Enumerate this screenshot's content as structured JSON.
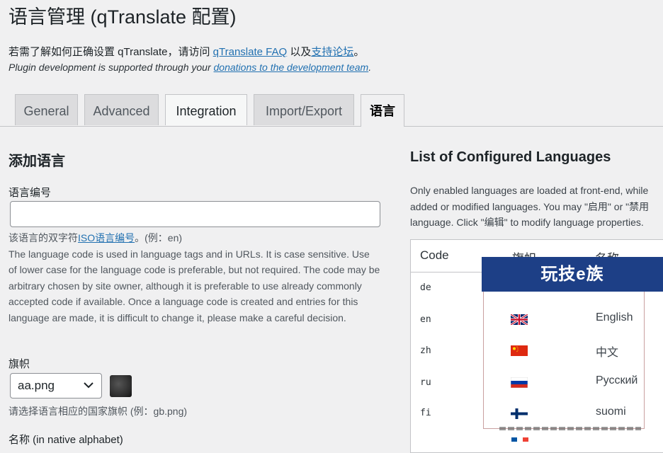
{
  "page_title": "语言管理 (qTranslate 配置)",
  "intro": {
    "prefix": "若需了解如何正确设置 qTranslate，请访问 ",
    "faq_link": "qTranslate FAQ",
    "middle": " 以及",
    "forum_link": "支持论坛",
    "suffix": "。"
  },
  "intro2": {
    "prefix": "Plugin development is supported through your ",
    "link": "donations to the development team",
    "suffix": "."
  },
  "tabs": [
    "General",
    "Advanced",
    "Integration",
    "Import/Export",
    "语言"
  ],
  "add_language": {
    "title": "添加语言",
    "code_label": "语言编号",
    "code_value": "",
    "hint_prefix": "该语言的双字符",
    "hint_link": "ISO语言编号",
    "hint_suffix": "。(例：en)",
    "hint_body": "The language code is used in language tags and in URLs. It is case sensitive. Use of lower case for the language code is preferable, but not required. The code may be arbitrary chosen by site owner, although it is preferable to use already commonly accepted code if available. Once a language code is created and entries for this language are made, it is difficult to change it, please make a careful decision.",
    "flag_label": "旗帜",
    "flag_value": "aa.png",
    "flag_hint": "请选择语言相应的国家旗帜 (例：gb.png)",
    "name_label": "名称 (in native alphabet)"
  },
  "configured": {
    "title": "List of Configured Languages",
    "desc_lines": [
      "Only enabled languages are loaded at front-end, while",
      "added or modified languages. You may \"启用\" or \"禁用",
      "language. Click \"编辑\" to modify language properties."
    ],
    "headers": [
      "Code",
      "旗帜",
      "名称"
    ],
    "codes": [
      "de",
      "en",
      "zh",
      "ru",
      "fi"
    ]
  },
  "overlay": {
    "banner": "玩技e族",
    "languages": [
      {
        "name": "English",
        "flag": "uk-flag-icon"
      },
      {
        "name": "中文",
        "flag": "china-flag-icon"
      },
      {
        "name": "Русский",
        "flag": "russia-flag-icon"
      },
      {
        "name": "suomi",
        "flag": "finland-flag-icon"
      }
    ]
  }
}
